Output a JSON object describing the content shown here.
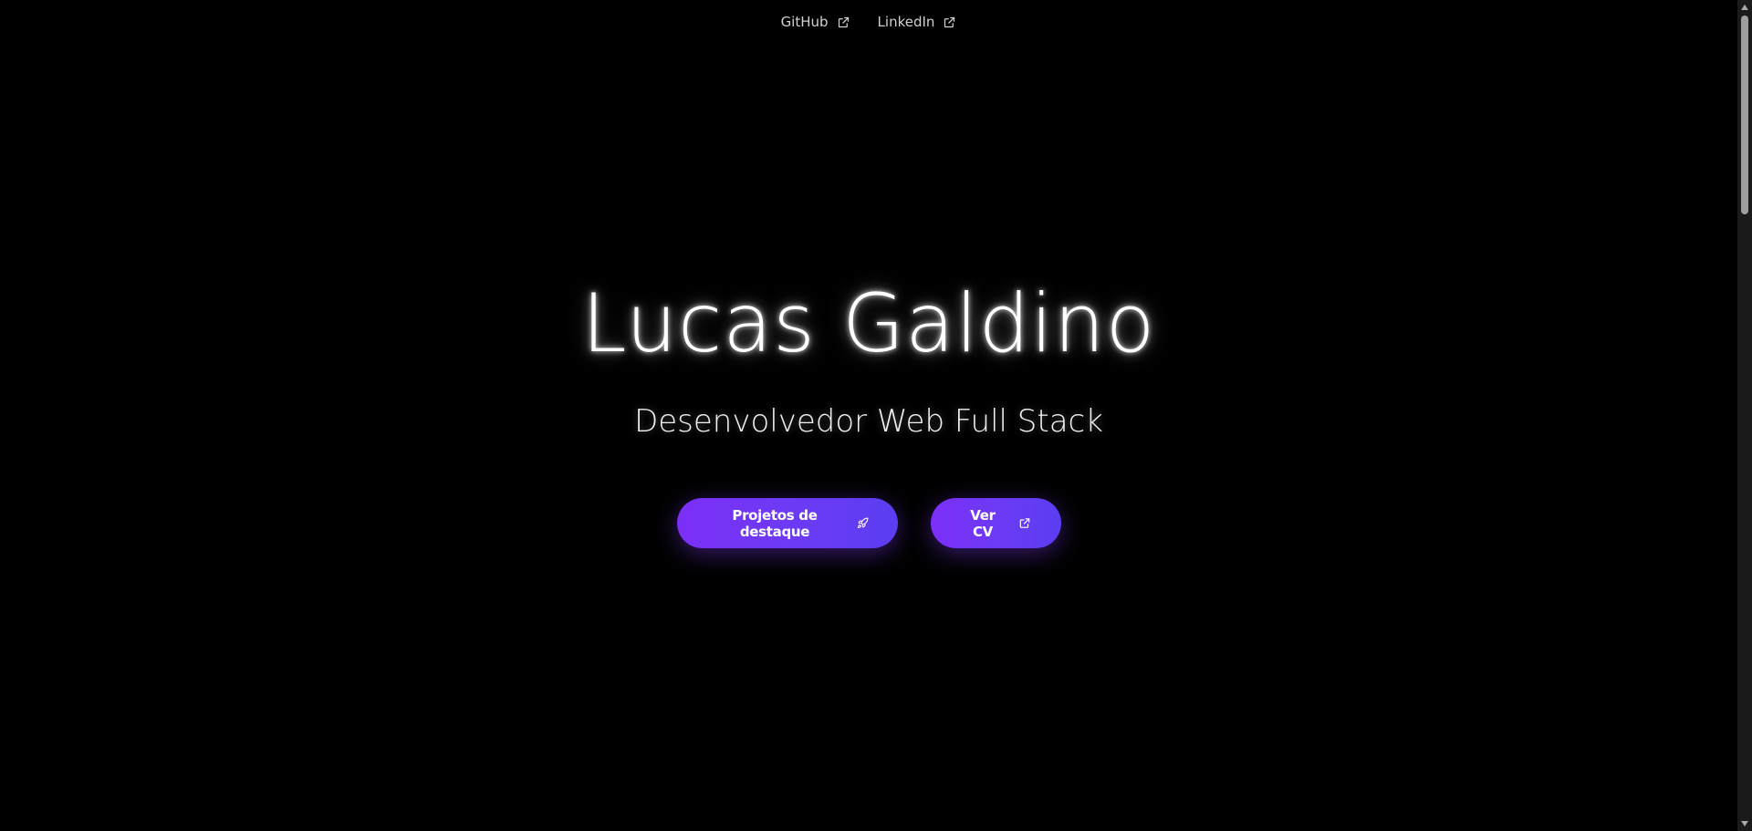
{
  "nav": {
    "links": [
      {
        "label": "GitHub",
        "icon": "external-link-icon"
      },
      {
        "label": "LinkedIn",
        "icon": "external-link-icon"
      }
    ]
  },
  "hero": {
    "title": "Lucas Galdino",
    "subtitle": "Desenvolvedor Web Full Stack"
  },
  "actions": {
    "projects_label": "Projetos de destaque",
    "projects_icon": "rocket-icon",
    "cv_label": "Ver CV",
    "cv_icon": "external-link-icon"
  },
  "colors": {
    "background": "#000000",
    "accent_start": "#7b2ff7",
    "accent_end": "#5b3df2",
    "text": "#ffffff"
  },
  "scrollbar": {
    "up_icon": "scroll-up-arrow-icon",
    "down_icon": "scroll-down-arrow-icon"
  }
}
